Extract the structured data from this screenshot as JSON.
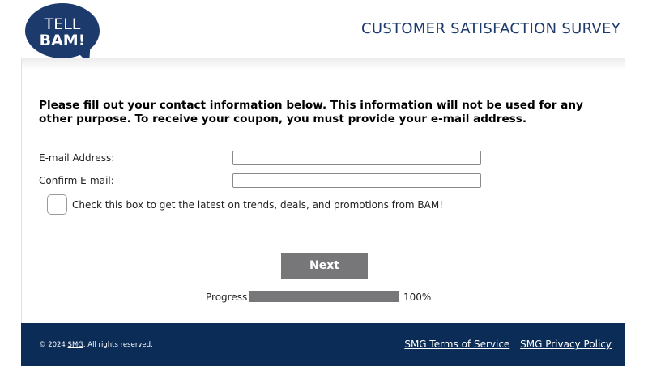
{
  "header": {
    "logo": {
      "line1": "TELL",
      "line2": "BAM!"
    },
    "title": "CUSTOMER SATISFACTION SURVEY"
  },
  "form": {
    "instructions": "Please fill out your contact information below. This information will not be used for any other purpose. To receive your coupon, you must provide your e-mail address.",
    "email_label": "E-mail Address:",
    "email_value": "",
    "confirm_label": "Confirm E-mail:",
    "confirm_value": "",
    "optin_label": "Check this box to get the latest on trends, deals, and promotions from BAM!",
    "optin_checked": false,
    "next_label": "Next"
  },
  "progress": {
    "label": "Progress",
    "value": 100,
    "value_text": "100%"
  },
  "footer": {
    "copyright_prefix": "© 2024 ",
    "copyright_link": "SMG",
    "copyright_suffix": ". All rights reserved.",
    "terms_link": "SMG Terms of Service",
    "privacy_link": "SMG Privacy Policy"
  },
  "colors": {
    "brand_navy": "#1d3a6c",
    "footer_bg": "#0b2c56",
    "button_gray": "#777779"
  }
}
